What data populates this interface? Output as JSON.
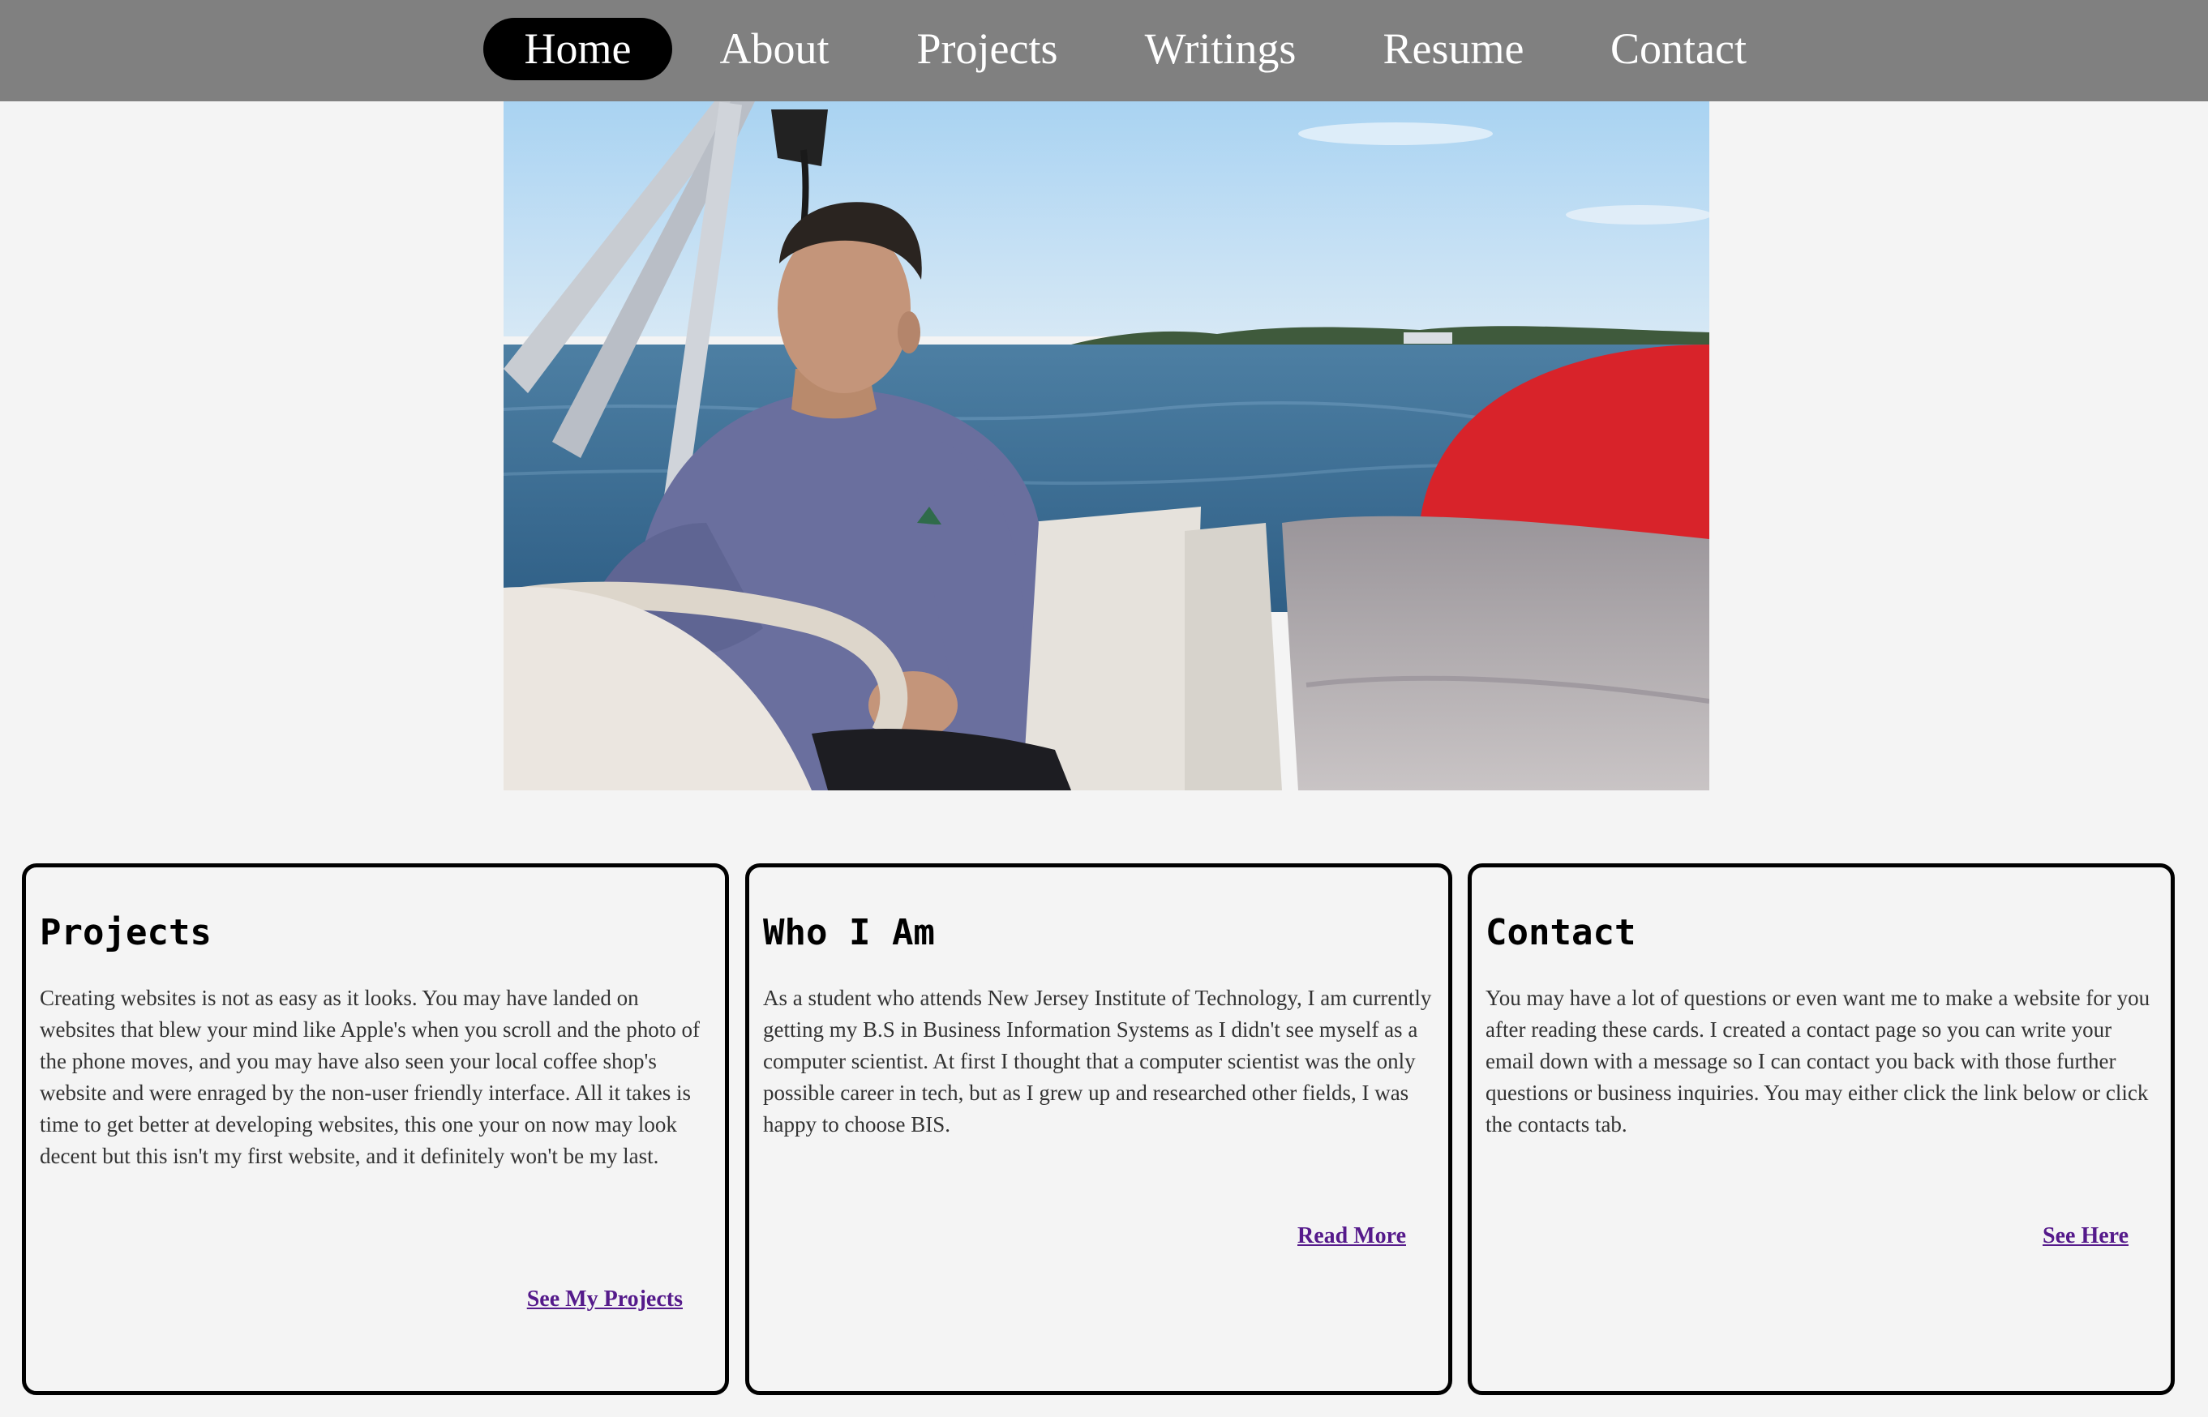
{
  "nav": {
    "items": [
      {
        "label": "Home",
        "active": true
      },
      {
        "label": "About"
      },
      {
        "label": "Projects"
      },
      {
        "label": "Writings"
      },
      {
        "label": "Resume"
      },
      {
        "label": "Contact"
      }
    ],
    "bar_color": "#808080",
    "active_color": "#000000"
  },
  "cards": [
    {
      "title": "Projects",
      "text": "Creating websites is not as easy as it looks. You may have landed on websites that blew your mind like Apple's when you scroll and the photo of the phone moves, and you may have also seen your local coffee shop's website and were enraged by the non-user friendly interface. All it takes is time to get better at developing websites, this one your on now may look decent but this isn't my first website, and it definitely won't be my last.",
      "link": "See My Projects"
    },
    {
      "title": "Who I Am",
      "text": "As a student who attends New Jersey Institute of Technology, I am currently getting my B.S in Business Information Systems as I didn't see myself as a computer scientist. At first I thought that a computer scientist was the only possible career in tech, but as I grew up and researched other fields, I was happy to choose BIS.",
      "link": "Read More"
    },
    {
      "title": "Contact",
      "text": "You may have a lot of questions or even want me to make a website for you after reading these cards. I created a contact page so you can write your email down with a message so I can contact you back with those further questions or business inquiries. You may either click the link below or click the contacts tab.",
      "link": "See Here"
    }
  ],
  "colors": {
    "background": "#f4f4f4",
    "link": "#551a8b",
    "card_border": "#000000"
  }
}
